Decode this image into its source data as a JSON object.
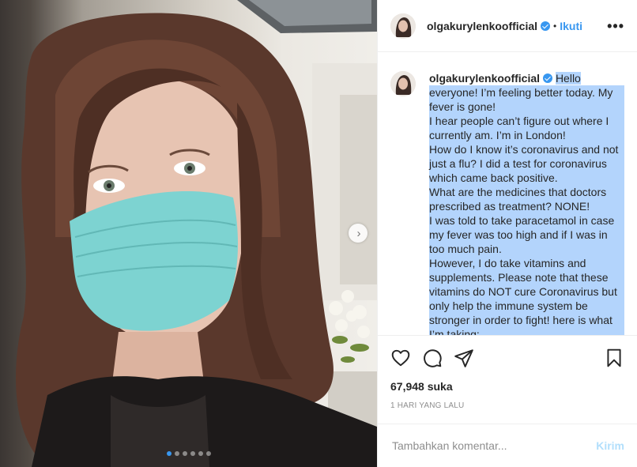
{
  "post": {
    "username": "olgakurylenkoofficial",
    "verified": true,
    "follow_label": "Ikuti",
    "separator": "•",
    "more_label": "•••",
    "carousel": {
      "total_slides": 6,
      "active_slide": 1
    },
    "caption_lines": [
      "Hello",
      "everyone! I’m feeling better today. My",
      "fever is gone!",
      "I hear people can’t figure out where I",
      "currently am. I’m in London!",
      "How do I know it’s coronavirus and not",
      "just a flu? I did a test for coronavirus",
      "which came back positive.",
      "What are the medicines that doctors",
      "prescribed as treatment? NONE!",
      "I was told to take paracetamol in case",
      "my fever was too high and if I was in",
      "too much pain.",
      "However, I do take vitamins and",
      "supplements. Please note that these",
      "vitamins do NOT cure Coronavirus but",
      "only help the immune system be",
      "stronger in order to fight! here is what",
      "I’m taking:"
    ],
    "likes": "67,948 suka",
    "timestamp": "1 HARI YANG LALU",
    "comment": {
      "placeholder": "Tambahkan komentar...",
      "post_label": "Kirim"
    },
    "icons": {
      "like": "heart-icon",
      "comment": "comment-icon",
      "share": "share-icon",
      "save": "bookmark-icon",
      "next": "chevron-right-icon"
    },
    "colors": {
      "link": "#3897f0",
      "post_disabled": "#b2dffc",
      "selection": "#b3d4fc"
    }
  }
}
